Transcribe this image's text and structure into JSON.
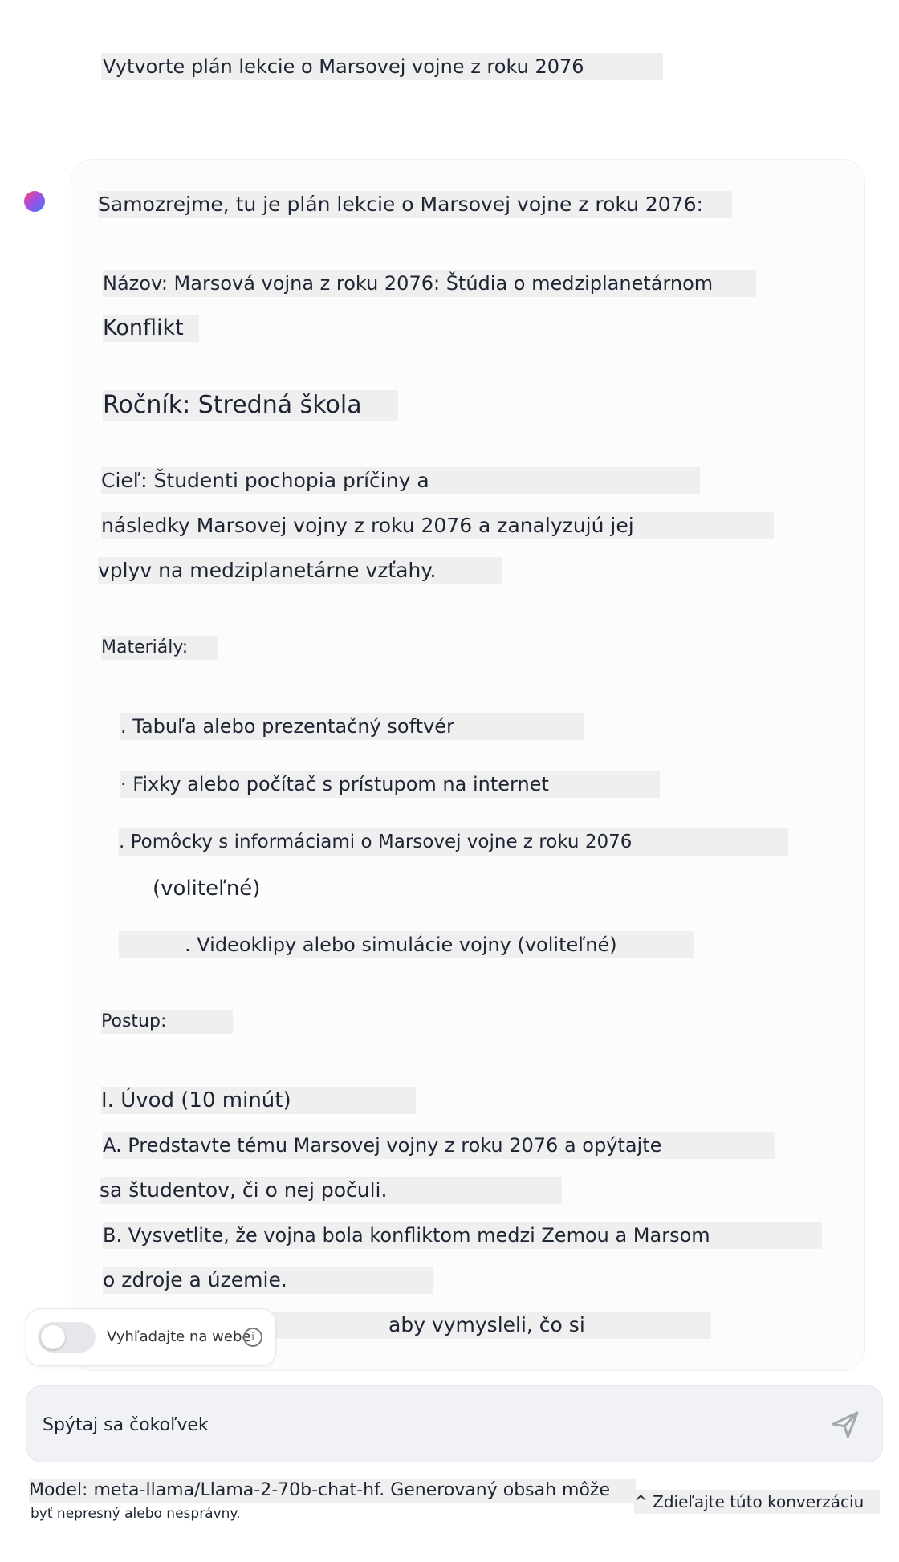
{
  "user_message": "Vytvorte plán lekcie o Marsovej vojne z roku 2076",
  "assistant": {
    "intro": "Samozrejme, tu je plán lekcie o Marsovej vojne z roku 2076:",
    "title_line1": "Názov: Marsová vojna z roku 2076: Štúdia o medziplanetárnom",
    "title_line2": "Konflikt",
    "grade": "Ročník: Stredná škola",
    "goal_line1": "Cieľ: Študenti pochopia príčiny a",
    "goal_line2": "následky Marsovej vojny z roku 2076 a zanalyzujú jej",
    "goal_line3": "vplyv na medziplanetárne vzťahy.",
    "materials_heading": "Materiály:",
    "materials": [
      ". Tabuľa alebo prezentačný softvér",
      "· Fixky alebo počítač s prístupom na internet",
      ". Pomôcky s informáciami o Marsovej vojne z roku 2076",
      "(voliteľné)",
      ". Videoklipy alebo simulácie vojny (voliteľné)"
    ],
    "procedure_heading": "Postup:",
    "section1_heading": "I. Úvod (10 minút)",
    "step_a_line1": "A. Predstavte tému Marsovej vojny z roku 2076 a opýtajte",
    "step_a_line2": "sa študentov, či o nej počuli.",
    "step_b_line1": "B. Vysvetlite, že vojna bola konfliktom medzi Zemou a Marsom",
    "step_b_line2": "o zdroje a územie.",
    "partial_line": "aby vymysleli, čo si"
  },
  "web_search": {
    "label": "Vyhľadajte na webe",
    "enabled": false
  },
  "input": {
    "placeholder": "Spýtaj sa čokoľvek"
  },
  "footer": {
    "model_line1": "Model: meta-llama/Llama-2-70b-chat-hf. Generovaný obsah môže",
    "model_line2": "byť nepresný alebo nesprávny.",
    "share": "^ Zdieľajte túto konverzáciu"
  },
  "icons": {
    "avatar": "assistant-avatar",
    "info": "info-icon",
    "send": "send-icon"
  }
}
